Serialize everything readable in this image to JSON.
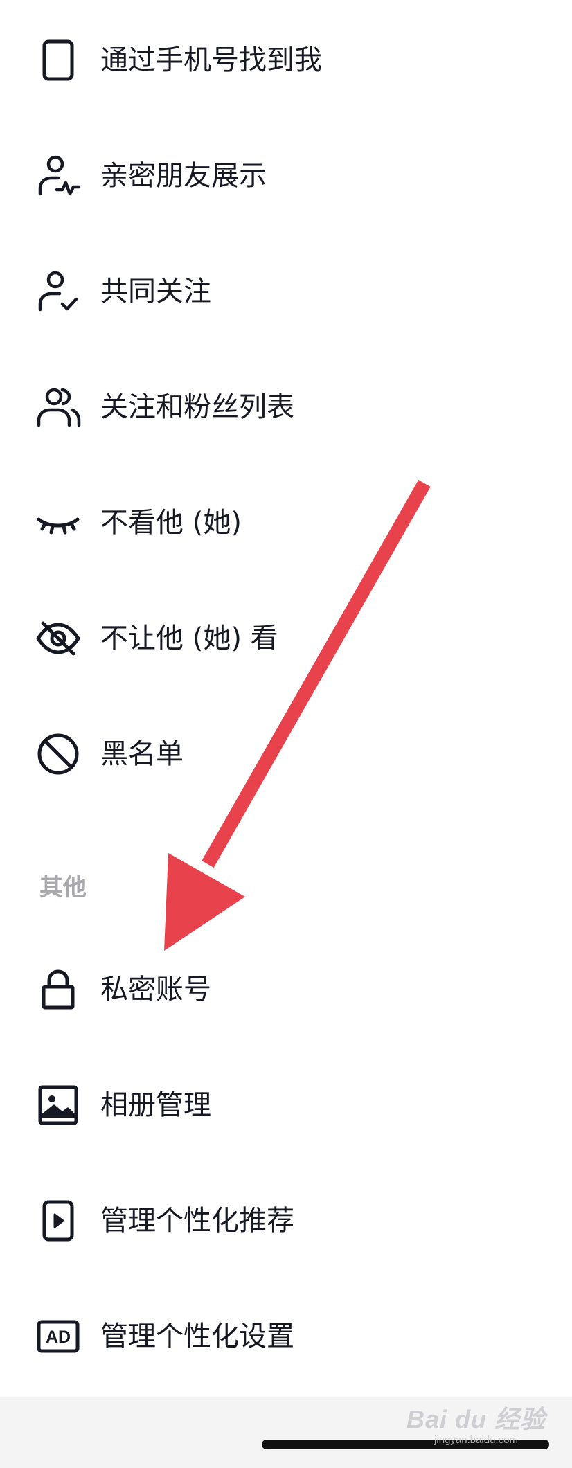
{
  "items": [
    {
      "label": "通过手机号找到我",
      "icon": "phone-icon"
    },
    {
      "label": "亲密朋友展示",
      "icon": "user-pulse-icon"
    },
    {
      "label": "共同关注",
      "icon": "user-check-icon"
    },
    {
      "label": "关注和粉丝列表",
      "icon": "users-icon"
    },
    {
      "label": "不看他 (她)",
      "icon": "closed-eye-icon"
    },
    {
      "label": "不让他 (她) 看",
      "icon": "eye-off-icon"
    },
    {
      "label": "黑名单",
      "icon": "block-icon"
    }
  ],
  "other_section": {
    "title": "其他",
    "items": [
      {
        "label": "私密账号",
        "icon": "lock-icon"
      },
      {
        "label": "相册管理",
        "icon": "image-icon"
      },
      {
        "label": "管理个性化推荐",
        "icon": "phone-play-icon"
      },
      {
        "label": "管理个性化设置",
        "icon": "ad-icon",
        "icon_text": "AD"
      }
    ]
  },
  "watermark": {
    "main": "Bai du 经验",
    "sub": "jingyan.baidu.com"
  },
  "colors": {
    "text": "#161823",
    "section": "#a8a8ad",
    "arrow": "#e8434c",
    "footer": "#f4f4f5"
  }
}
